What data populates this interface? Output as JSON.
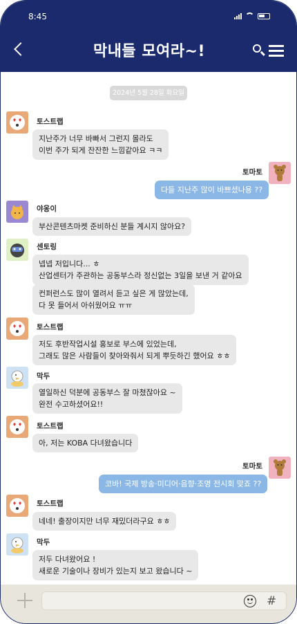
{
  "status_bar": {
    "time": "8:45"
  },
  "header": {
    "title": "막내들 모여라~!"
  },
  "chat": {
    "date": "2024년 5월 28일 화요일",
    "messages": [
      {
        "sender": "토스트랩",
        "lines": [
          "지난주가 너무 바빠서 그런지 몰라도",
          "이번 주가 되게 잔잔한 느낌같아요 ㅋㅋ"
        ]
      },
      {
        "sender": "토마토",
        "lines": [
          "다들 지난주 많이 바쁘셨나용 ??"
        ]
      },
      {
        "sender": "야옹이",
        "lines": [
          "부산콘텐츠마켓 준비하신 분들 계시지 않아요?"
        ]
      },
      {
        "sender": "센토링",
        "lines": [
          "넵넵 저입니다... ㅎ",
          "산업센터가 주관하는 공동부스라 정신없는 3일을 보낸 거 같아요"
        ]
      },
      {
        "sender": "",
        "lines": [
          "컨퍼런스도 많이 열려서 듣고 싶은 게 많았는데,",
          "다 못 들어서 아쉬웠어요 ㅠㅠ"
        ]
      },
      {
        "sender": "토스트랩",
        "lines": [
          "저도 후반작업시설 홍보로 부스에 있었는데,",
          "그래도 많은 사람들이 찾아와줘서 되게 뿌듯하긴 했어요 ㅎㅎ"
        ]
      },
      {
        "sender": "막두",
        "lines": [
          "열일하신 덕분에 공동부스 잘 마쳤잖아요 ~",
          "완전 수고하셨어요!!"
        ]
      },
      {
        "sender": "토스트랩",
        "lines": [
          "아, 저는 KOBA 다녀왔습니다"
        ]
      },
      {
        "sender": "토마토",
        "lines": [
          "코바! 국제 방송·미디어·음향·조명 전시회 맞죠 ??"
        ]
      },
      {
        "sender": "토스트랩",
        "lines": [
          "네네! 출장이지만 너무 재밌더라구요 ㅎㅎ"
        ]
      },
      {
        "sender": "막두",
        "lines": [
          "저두 다녀왔어요 !",
          "새로운 기술이나 장비가 있는지 보고 왔습니다 ~"
        ]
      }
    ]
  },
  "composer": {
    "input_value": ""
  },
  "colors": {
    "header_bg": "#1a2a6c",
    "my_bubble": "#8ab7e5",
    "other_bubble": "#e8e8e8",
    "composer_bg": "#e8e5dc"
  },
  "icons": {
    "back": "chevron-left-icon",
    "search": "search-icon",
    "menu": "hamburger-menu-icon",
    "add": "plus-icon",
    "emoji": "smiley-icon",
    "hashtag": "hash-icon"
  }
}
